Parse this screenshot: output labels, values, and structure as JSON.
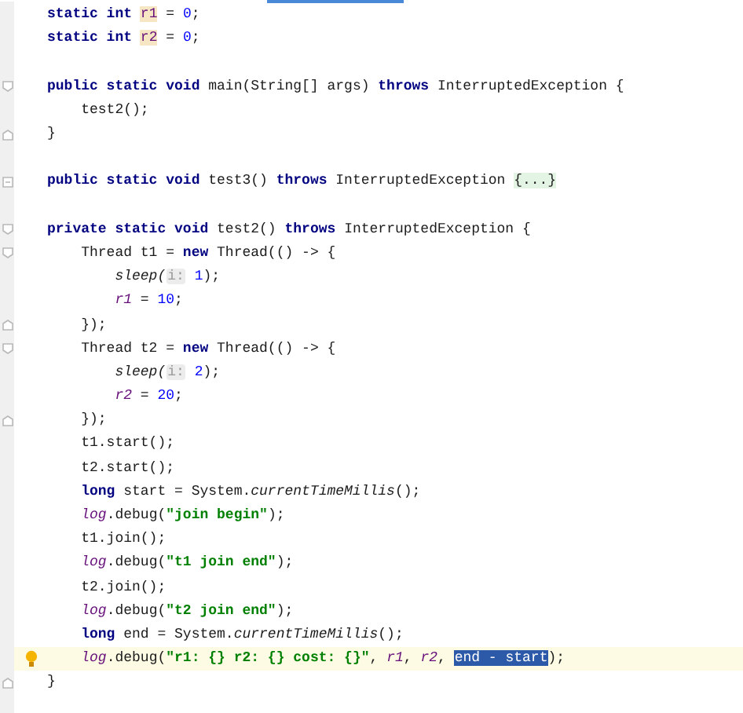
{
  "editor": {
    "blocks": [
      {
        "lines": [
          {
            "kind": "plain",
            "tokens": [
              {
                "kind": "kw",
                "text": "static int "
              },
              {
                "kind": "field-decl",
                "text": "r1"
              },
              {
                "kind": "plain",
                "text": " = "
              },
              {
                "kind": "num",
                "text": "0"
              },
              {
                "kind": "plain",
                "text": ";"
              }
            ]
          },
          {
            "kind": "plain",
            "tokens": [
              {
                "kind": "kw",
                "text": "static int "
              },
              {
                "kind": "field-decl",
                "text": "r2"
              },
              {
                "kind": "plain",
                "text": " = "
              },
              {
                "kind": "num",
                "text": "0"
              },
              {
                "kind": "plain",
                "text": ";"
              }
            ]
          }
        ]
      },
      {
        "lines": [
          {
            "kind": "fold-start",
            "tokens": [
              {
                "kind": "kw",
                "text": "public static void "
              },
              {
                "kind": "plain",
                "text": "main(String[] args) "
              },
              {
                "kind": "kw",
                "text": "throws "
              },
              {
                "kind": "plain",
                "text": "InterruptedException {"
              }
            ]
          },
          {
            "kind": "plain",
            "tokens": [
              {
                "kind": "plain",
                "text": "    test2();"
              }
            ]
          },
          {
            "kind": "fold-end",
            "tokens": [
              {
                "kind": "plain",
                "text": "}"
              }
            ]
          }
        ]
      },
      {
        "lines": [
          {
            "kind": "folded",
            "tokens": [
              {
                "kind": "kw",
                "text": "public static void "
              },
              {
                "kind": "plain",
                "text": "test3() "
              },
              {
                "kind": "kw",
                "text": "throws "
              },
              {
                "kind": "plain",
                "text": "InterruptedException "
              },
              {
                "kind": "folded",
                "text": "{...}"
              }
            ]
          }
        ]
      },
      {
        "lines": [
          {
            "kind": "fold-start",
            "tokens": [
              {
                "kind": "kw",
                "text": "private static void "
              },
              {
                "kind": "plain",
                "text": "test2() "
              },
              {
                "kind": "kw",
                "text": "throws "
              },
              {
                "kind": "plain",
                "text": "InterruptedException {"
              }
            ]
          },
          {
            "kind": "fold-start",
            "tokens": [
              {
                "kind": "plain",
                "text": "    Thread t1 = "
              },
              {
                "kind": "kw",
                "text": "new "
              },
              {
                "kind": "plain",
                "text": "Thread(() -> {"
              }
            ]
          },
          {
            "kind": "plain",
            "tokens": [
              {
                "kind": "call",
                "text": "        sleep("
              },
              {
                "kind": "hint",
                "text": "i:"
              },
              {
                "kind": "num",
                "text": " 1"
              },
              {
                "kind": "plain",
                "text": ");"
              }
            ]
          },
          {
            "kind": "plain",
            "tokens": [
              {
                "kind": "field",
                "text": "        r1"
              },
              {
                "kind": "plain",
                "text": " = "
              },
              {
                "kind": "num",
                "text": "10"
              },
              {
                "kind": "plain",
                "text": ";"
              }
            ]
          },
          {
            "kind": "fold-end",
            "tokens": [
              {
                "kind": "plain",
                "text": "    });"
              }
            ]
          },
          {
            "kind": "fold-start",
            "tokens": [
              {
                "kind": "plain",
                "text": "    Thread t2 = "
              },
              {
                "kind": "kw",
                "text": "new "
              },
              {
                "kind": "plain",
                "text": "Thread(() -> {"
              }
            ]
          },
          {
            "kind": "plain",
            "tokens": [
              {
                "kind": "call",
                "text": "        sleep("
              },
              {
                "kind": "hint",
                "text": "i:"
              },
              {
                "kind": "num",
                "text": " 2"
              },
              {
                "kind": "plain",
                "text": ");"
              }
            ]
          },
          {
            "kind": "plain",
            "tokens": [
              {
                "kind": "field",
                "text": "        r2"
              },
              {
                "kind": "plain",
                "text": " = "
              },
              {
                "kind": "num",
                "text": "20"
              },
              {
                "kind": "plain",
                "text": ";"
              }
            ]
          },
          {
            "kind": "fold-end",
            "tokens": [
              {
                "kind": "plain",
                "text": "    });"
              }
            ]
          },
          {
            "kind": "plain",
            "tokens": [
              {
                "kind": "plain",
                "text": "    t1.start();"
              }
            ]
          },
          {
            "kind": "plain",
            "tokens": [
              {
                "kind": "plain",
                "text": "    t2.start();"
              }
            ]
          },
          {
            "kind": "plain",
            "tokens": [
              {
                "kind": "kw",
                "text": "    long "
              },
              {
                "kind": "plain",
                "text": "start = System."
              },
              {
                "kind": "call",
                "text": "currentTimeMillis"
              },
              {
                "kind": "plain",
                "text": "();"
              }
            ]
          },
          {
            "kind": "plain",
            "tokens": [
              {
                "kind": "field",
                "text": "    log"
              },
              {
                "kind": "plain",
                "text": ".debug("
              },
              {
                "kind": "str",
                "text": "\"join begin\""
              },
              {
                "kind": "plain",
                "text": ");"
              }
            ]
          },
          {
            "kind": "plain",
            "tokens": [
              {
                "kind": "plain",
                "text": "    t1.join();"
              }
            ]
          },
          {
            "kind": "plain",
            "tokens": [
              {
                "kind": "field",
                "text": "    log"
              },
              {
                "kind": "plain",
                "text": ".debug("
              },
              {
                "kind": "str",
                "text": "\"t1 join end\""
              },
              {
                "kind": "plain",
                "text": ");"
              }
            ]
          },
          {
            "kind": "plain",
            "tokens": [
              {
                "kind": "plain",
                "text": "    t2.join();"
              }
            ]
          },
          {
            "kind": "plain",
            "tokens": [
              {
                "kind": "field",
                "text": "    log"
              },
              {
                "kind": "plain",
                "text": ".debug("
              },
              {
                "kind": "str",
                "text": "\"t2 join end\""
              },
              {
                "kind": "plain",
                "text": ");"
              }
            ]
          },
          {
            "kind": "plain",
            "tokens": [
              {
                "kind": "kw",
                "text": "    long "
              },
              {
                "kind": "plain",
                "text": "end = System."
              },
              {
                "kind": "call",
                "text": "currentTimeMillis"
              },
              {
                "kind": "plain",
                "text": "();"
              }
            ]
          },
          {
            "kind": "plain",
            "current": true,
            "bulb": true,
            "tokens": [
              {
                "kind": "field",
                "text": "    log"
              },
              {
                "kind": "plain",
                "text": ".debug("
              },
              {
                "kind": "str",
                "text": "\"r1: {} r2: {} cost: {}\""
              },
              {
                "kind": "plain",
                "text": ", "
              },
              {
                "kind": "field",
                "text": "r1"
              },
              {
                "kind": "plain",
                "text": ", "
              },
              {
                "kind": "field",
                "text": "r2"
              },
              {
                "kind": "plain",
                "text": ", "
              },
              {
                "kind": "selected",
                "text": "end - start"
              },
              {
                "kind": "plain",
                "text": ");"
              }
            ]
          },
          {
            "kind": "fold-end",
            "tokens": [
              {
                "kind": "plain",
                "text": "}"
              }
            ]
          }
        ]
      }
    ]
  }
}
